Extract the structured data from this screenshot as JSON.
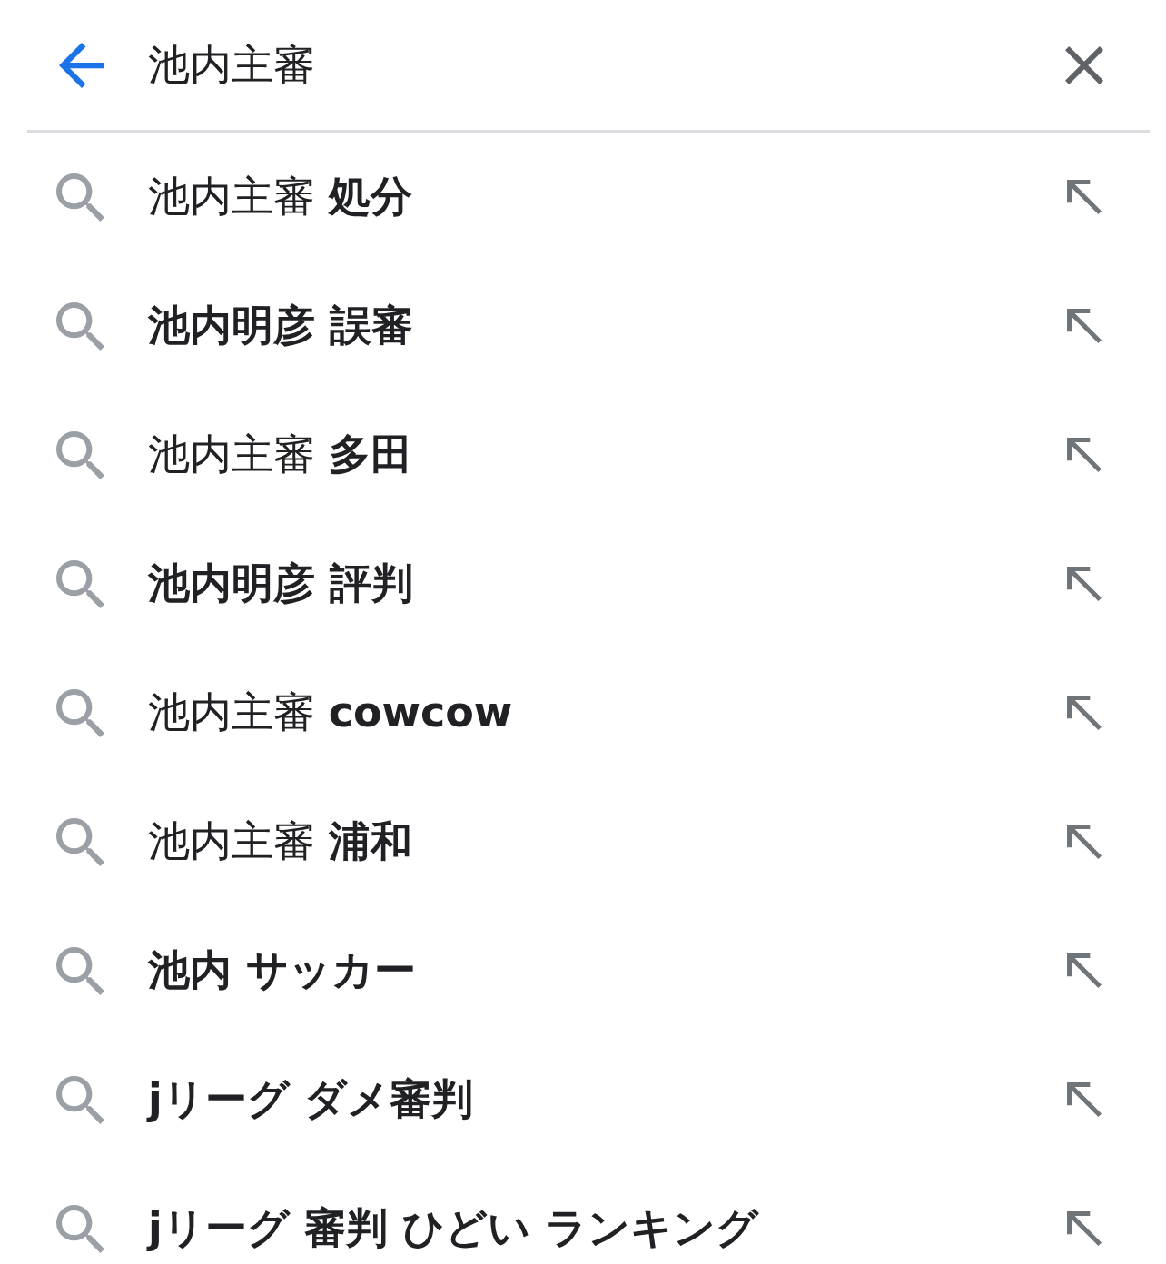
{
  "search": {
    "value": "池内主審"
  },
  "suggestions": [
    {
      "typed": "池内主審",
      "suggested": "処分"
    },
    {
      "suggested": "池内明彦 誤審"
    },
    {
      "typed": "池内主審",
      "suggested": "多田"
    },
    {
      "suggested": "池内明彦 評判"
    },
    {
      "typed": "池内主審",
      "suggested": "cowcow"
    },
    {
      "typed": "池内主審",
      "suggested": "浦和"
    },
    {
      "suggested": "池内 サッカー"
    },
    {
      "suggested": "jリーグ ダメ審判"
    },
    {
      "suggested": "jリーグ 審判 ひどい ランキング"
    }
  ]
}
